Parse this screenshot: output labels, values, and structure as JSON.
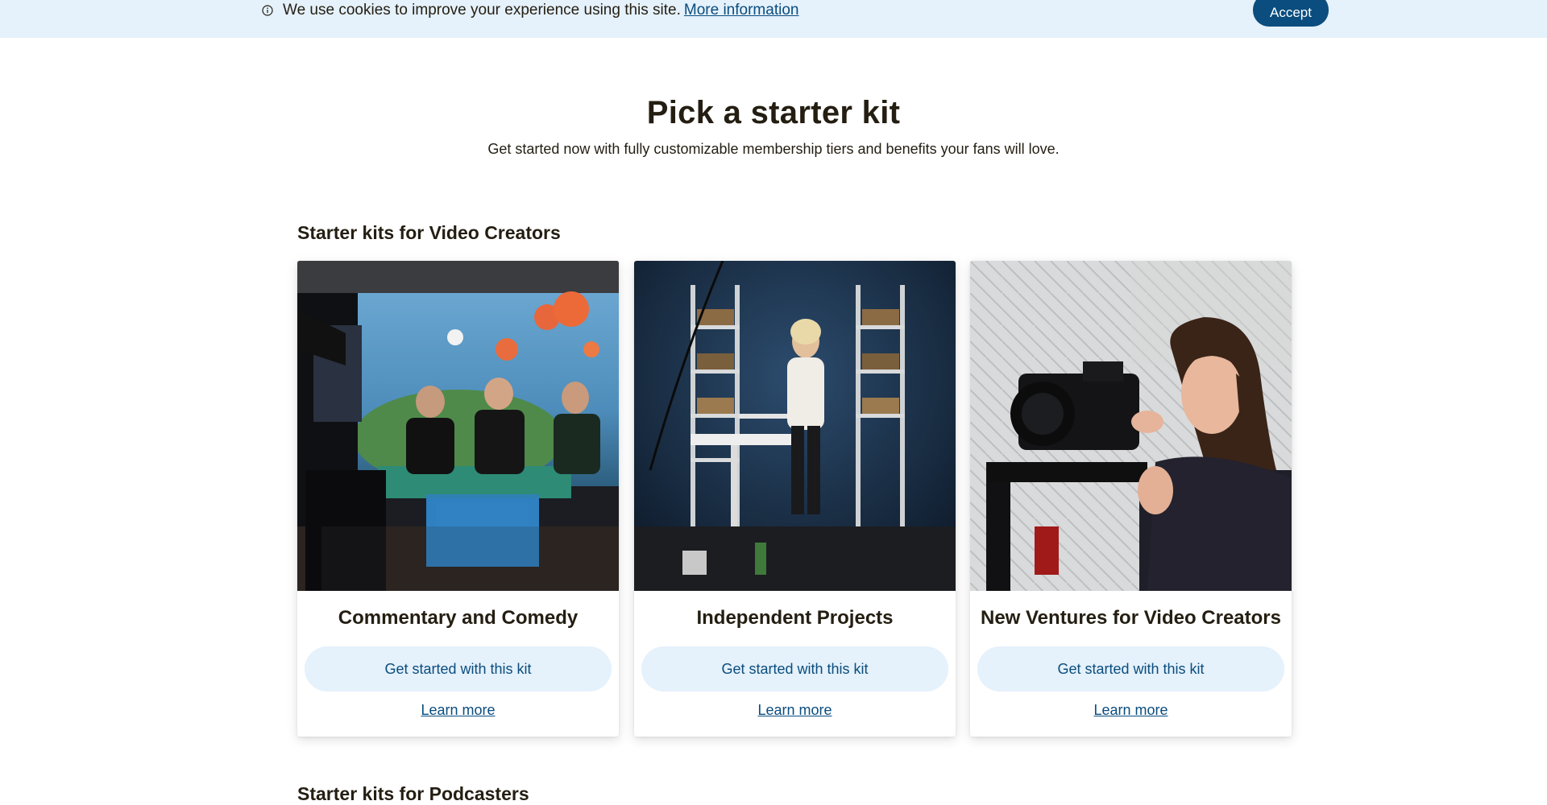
{
  "cookie_banner": {
    "message": "We use cookies to improve your experience using this site.",
    "link_label": "More information",
    "accept_label": "Accept",
    "icon": "info-circle-icon"
  },
  "header": {
    "title": "Pick a starter kit",
    "subtitle": "Get started now with fully customizable membership tiers and benefits your fans will love."
  },
  "sections": [
    {
      "title": "Starter kits for Video Creators",
      "cards": [
        {
          "title": "Commentary and Comedy",
          "button_label": "Get started with this kit",
          "link_label": "Learn more",
          "image": "podcast-studio-photo"
        },
        {
          "title": "Independent Projects",
          "button_label": "Get started with this kit",
          "link_label": "Learn more",
          "image": "creator-studio-photo"
        },
        {
          "title": "New Ventures for Video Creators",
          "button_label": "Get started with this kit",
          "link_label": "Learn more",
          "image": "camera-operator-photo"
        }
      ]
    },
    {
      "title": "Starter kits for Podcasters"
    }
  ],
  "colors": {
    "banner_bg": "#e5f1fb",
    "brand_blue": "#0a4d7e",
    "text": "#241e12",
    "button_light": "#e5f1fb"
  }
}
